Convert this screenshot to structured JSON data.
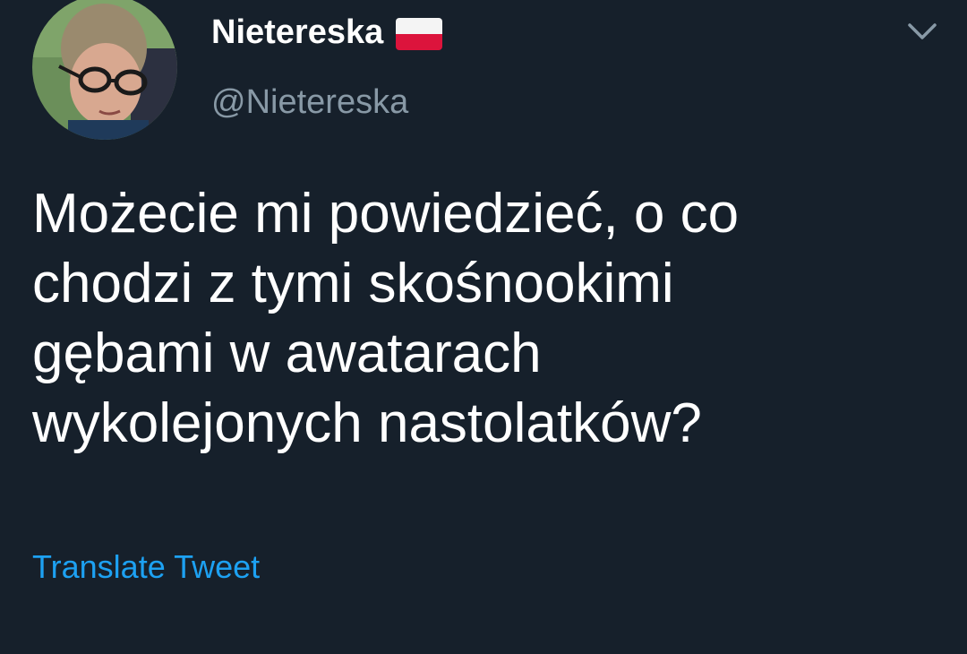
{
  "author": {
    "display_name": "Nietereska",
    "flag_icon": "poland-flag-icon",
    "handle": "@Nietereska",
    "avatar": "profile-photo"
  },
  "menu": {
    "icon": "chevron-down-icon"
  },
  "tweet": {
    "text": "Możecie mi powiedzieć, o co\nchodzi z tymi skośnookimi\ngębami w awatarach\nwykolejonych nastolatków?",
    "translate_label": "Translate Tweet"
  },
  "colors": {
    "background": "#16202b",
    "primary_text": "#ffffff",
    "secondary_text": "#8899a6",
    "link": "#1da1f2"
  }
}
